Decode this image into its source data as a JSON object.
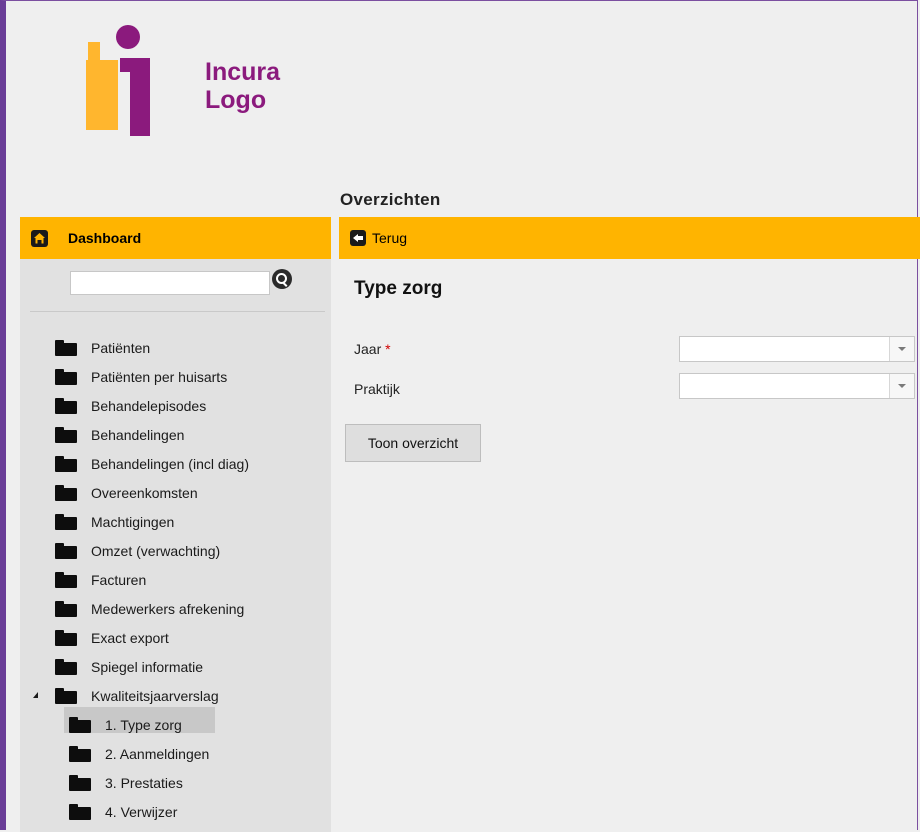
{
  "logo": {
    "line1": "Incura",
    "line2": "Logo"
  },
  "sidebar": {
    "title": "Dashboard",
    "search": {
      "value": "",
      "placeholder": ""
    },
    "items": [
      {
        "label": "Patiënten"
      },
      {
        "label": "Patiënten per huisarts"
      },
      {
        "label": "Behandelepisodes"
      },
      {
        "label": "Behandelingen"
      },
      {
        "label": "Behandelingen (incl diag)"
      },
      {
        "label": "Overeenkomsten"
      },
      {
        "label": "Machtigingen"
      },
      {
        "label": "Omzet (verwachting)"
      },
      {
        "label": "Facturen"
      },
      {
        "label": "Medewerkers afrekening"
      },
      {
        "label": "Exact export"
      },
      {
        "label": "Spiegel informatie"
      },
      {
        "label": "Kwaliteitsjaarverslag",
        "expanded": true
      },
      {
        "label": "1. Type zorg",
        "selected": true
      },
      {
        "label": "2. Aanmeldingen"
      },
      {
        "label": "3. Prestaties"
      },
      {
        "label": "4. Verwijzer"
      }
    ]
  },
  "main": {
    "page_title": "Overzichten",
    "back_label": "Terug",
    "form_title": "Type zorg",
    "fields": [
      {
        "label": "Jaar",
        "required": "*",
        "value": ""
      },
      {
        "label": "Praktijk",
        "value": ""
      }
    ],
    "submit_label": "Toon overzicht"
  },
  "colors": {
    "accent": "#ffb400",
    "brand": "#8b1a7d",
    "logo_yellow": "#ffb62e",
    "required": "#d00000"
  }
}
